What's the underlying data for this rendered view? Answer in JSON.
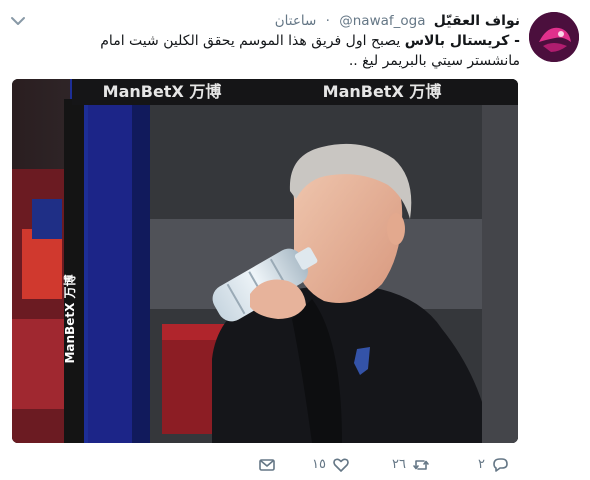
{
  "tweet": {
    "display_name": "نواف العقيّل",
    "handle": "@nawaf_oga",
    "separator": "·",
    "time": "ساعتان",
    "text_bold": "- كريستال بالاس",
    "text_rest": " يصبح اول فريق هذا الموسم يحقق الكلين شيت امام مانشستر سيتي بالبريمر ليغ ..",
    "media": {
      "sponsor_text": "ManBetX 万博",
      "subject": "man drinking from water bottle"
    }
  },
  "actions": {
    "reply_count": "٢",
    "retweet_count": "٢٦",
    "like_count": "١٥"
  },
  "icons": {
    "caret": "chevron-down-icon",
    "reply": "reply-icon",
    "retweet": "retweet-icon",
    "like": "heart-icon",
    "dm": "envelope-icon"
  },
  "colors": {
    "icon_gray": "#657786",
    "text": "#14171a",
    "avatar_bg": "#4b0f3d"
  }
}
